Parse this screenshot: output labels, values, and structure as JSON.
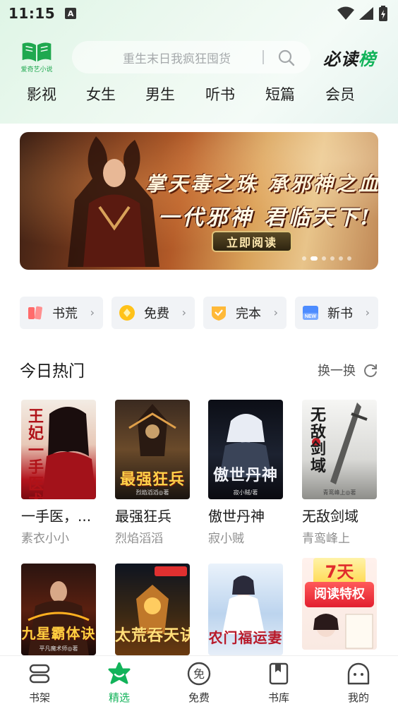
{
  "status_bar": {
    "time": "11:15",
    "notification_letter": "A"
  },
  "header": {
    "logo_text": "爱奇艺小说",
    "search_placeholder": "重生末日我疯狂囤货",
    "ranking_label_part1": "必读",
    "ranking_label_part2": "榜"
  },
  "tabs": [
    {
      "label": "影视"
    },
    {
      "label": "女生"
    },
    {
      "label": "男生"
    },
    {
      "label": "听书"
    },
    {
      "label": "短篇"
    },
    {
      "label": "会员"
    }
  ],
  "banner": {
    "line1": "掌天毒之珠 承邪神之血",
    "line2": "一代邪神 君临天下!",
    "button_label": "立即阅读",
    "dot_count": 6,
    "active_dot": 1
  },
  "quick_chips": [
    {
      "label": "书荒",
      "icon": "book-shortage-icon"
    },
    {
      "label": "免费",
      "icon": "coin-icon"
    },
    {
      "label": "完本",
      "icon": "shield-check-icon"
    },
    {
      "label": "新书",
      "icon": "new-book-icon"
    }
  ],
  "hot_today": {
    "title": "今日热门",
    "refresh_label": "换一换",
    "books": [
      {
        "title": "一手医，...",
        "author": "素衣小小",
        "cover_text": "王妃一手医术",
        "cover_author": ""
      },
      {
        "title": "最强狂兵",
        "author": "烈焰滔滔",
        "cover_text": "最强狂兵",
        "cover_author": "烈焰滔滔◎著"
      },
      {
        "title": "傲世丹神",
        "author": "寂小贼",
        "cover_text": "傲世丹神",
        "cover_author": "寂小贼/著"
      },
      {
        "title": "无敌剑域",
        "author": "青鸾峰上",
        "cover_text": "无敌剑域",
        "cover_author": "青鸾峰上◎著"
      }
    ],
    "row2_covers": [
      {
        "cover_text": "九星霸体诀",
        "cover_author": "平凡魔术师◎著"
      },
      {
        "cover_text": "太荒吞天诀",
        "cover_author": ""
      },
      {
        "cover_text": "农门福运妻",
        "cover_author": ""
      },
      {
        "promo_top": "7天",
        "promo_bottom": "阅读特权"
      }
    ]
  },
  "bottom_nav": [
    {
      "label": "书架",
      "icon": "bookshelf-icon",
      "active": false
    },
    {
      "label": "精选",
      "icon": "featured-icon",
      "active": true
    },
    {
      "label": "免费",
      "icon": "free-icon",
      "active": false
    },
    {
      "label": "书库",
      "icon": "library-icon",
      "active": false
    },
    {
      "label": "我的",
      "icon": "profile-icon",
      "active": false
    }
  ],
  "colors": {
    "accent_green": "#12b35a",
    "banner_gold": "#e0c27a"
  }
}
